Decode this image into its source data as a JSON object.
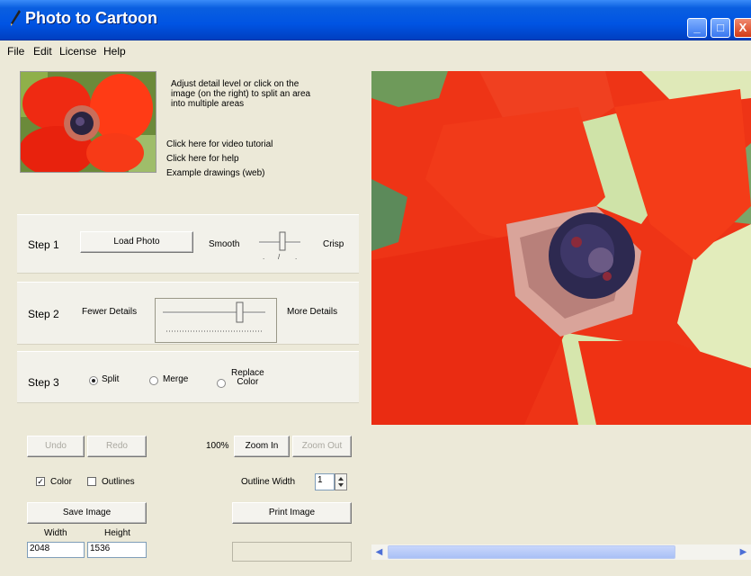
{
  "window": {
    "title": "Photo to Cartoon",
    "controls": {
      "minimize": "_",
      "maximize": "□",
      "close": "X"
    }
  },
  "menu": [
    "File",
    "Edit",
    "License",
    "Help"
  ],
  "info": {
    "lines": [
      "Adjust detail level or click on the",
      "image (on the right) to split an area",
      "into multiple areas"
    ],
    "links": [
      "Click here for video tutorial",
      "Click here for help",
      "Example drawings (web)"
    ]
  },
  "step1": {
    "label": "Step 1",
    "load_button": "Load Photo",
    "smooth": "Smooth",
    "crisp": "Crisp"
  },
  "step2": {
    "label": "Step 2",
    "fewer": "Fewer Details",
    "more": "More Details"
  },
  "step3": {
    "label": "Step 3",
    "options": [
      "Split",
      "Merge",
      "Replace\nColor"
    ],
    "selected": "Split"
  },
  "toolbar": {
    "undo": "Undo",
    "redo": "Redo",
    "zoom_level": "100%",
    "zoom_in": "Zoom In",
    "zoom_out": "Zoom Out",
    "color_label": "Color",
    "color_checked": true,
    "outlines_label": "Outlines",
    "outlines_checked": false,
    "outline_width_label": "Outline Width",
    "outline_width_value": "1",
    "save": "Save Image",
    "print": "Print Image",
    "width_label": "Width",
    "height_label": "Height",
    "width_value": "2048",
    "height_value": "1536"
  },
  "scrollbar": {
    "left_arrow": "◀",
    "right_arrow": "▶"
  },
  "colors": {
    "title_blue": "#0054e3",
    "petal_red": "#f23a1a",
    "background": "#ece9d8"
  }
}
